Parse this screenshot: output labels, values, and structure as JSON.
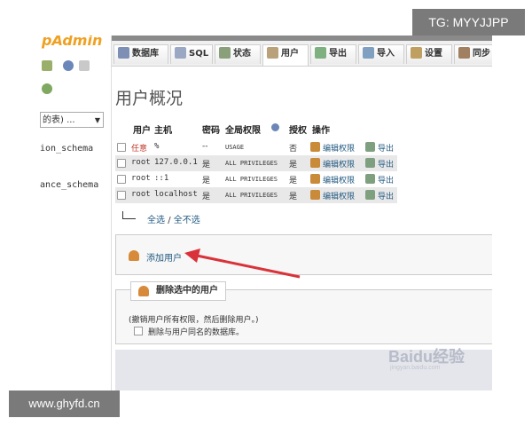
{
  "watermarks": {
    "top_right": "TG: MYYJJPP",
    "bottom_left": "www.ghyfd.cn",
    "baidu": "Baidu经验",
    "baidu_sub": "jingyan.baidu.com"
  },
  "sidebar": {
    "logo": "pAdmin",
    "db_select": "的表) ...",
    "db_items": [
      "ion_schema",
      "ance_schema"
    ]
  },
  "tabs": [
    {
      "label": "数据库",
      "icon": "database-icon"
    },
    {
      "label": "SQL",
      "icon": "sql-icon"
    },
    {
      "label": "状态",
      "icon": "status-icon"
    },
    {
      "label": "用户",
      "icon": "users-icon"
    },
    {
      "label": "导出",
      "icon": "export-icon"
    },
    {
      "label": "导入",
      "icon": "import-icon"
    },
    {
      "label": "设置",
      "icon": "settings-icon"
    },
    {
      "label": "同步",
      "icon": "sync-icon"
    }
  ],
  "page_title": "用户概况",
  "table": {
    "headers": [
      "用户",
      "主机",
      "密码",
      "全局权限",
      "授权",
      "操作"
    ],
    "rows": [
      {
        "user": "任意",
        "host": "%",
        "password": "--",
        "privileges": "USAGE",
        "grant": "否",
        "edit": "编辑权限",
        "export": "导出"
      },
      {
        "user": "root",
        "host": "127.0.0.1",
        "password": "是",
        "privileges": "ALL PRIVILEGES",
        "grant": "是",
        "edit": "编辑权限",
        "export": "导出"
      },
      {
        "user": "root",
        "host": "::1",
        "password": "是",
        "privileges": "ALL PRIVILEGES",
        "grant": "是",
        "edit": "编辑权限",
        "export": "导出"
      },
      {
        "user": "root",
        "host": "localhost",
        "password": "是",
        "privileges": "ALL PRIVILEGES",
        "grant": "是",
        "edit": "编辑权限",
        "export": "导出"
      }
    ]
  },
  "select_all": "全选",
  "select_sep": "/",
  "select_none": "全不选",
  "add_user": "添加用户",
  "delete_section": {
    "legend": "删除选中的用户",
    "note": "(撤销用户所有权限，然后删除用户。)",
    "option": "删除与用户同名的数据库。"
  },
  "colors": {
    "link": "#235a81",
    "annotation_arrow": "#d9323a",
    "logo": "#f0a020"
  }
}
